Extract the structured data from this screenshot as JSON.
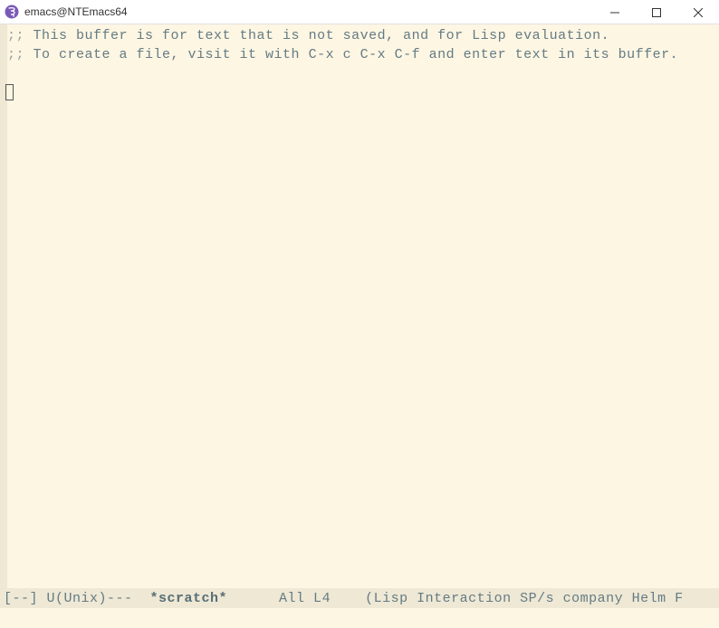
{
  "window": {
    "title": "emacs@NTEmacs64"
  },
  "buffer": {
    "line1_prefix": ";;",
    "line1_text": " This buffer is for text that is not saved, and for Lisp evaluation.",
    "line2_prefix": ";;",
    "line2_text": " To create a file, visit it with C-x c C-x C-f and enter text in its buffer."
  },
  "modeline": {
    "status": "[--] U(Unix)---  ",
    "buffer_name": "*scratch*",
    "position": "      All L4    ",
    "modes": "(Lisp Interaction SP/s company Helm F"
  }
}
